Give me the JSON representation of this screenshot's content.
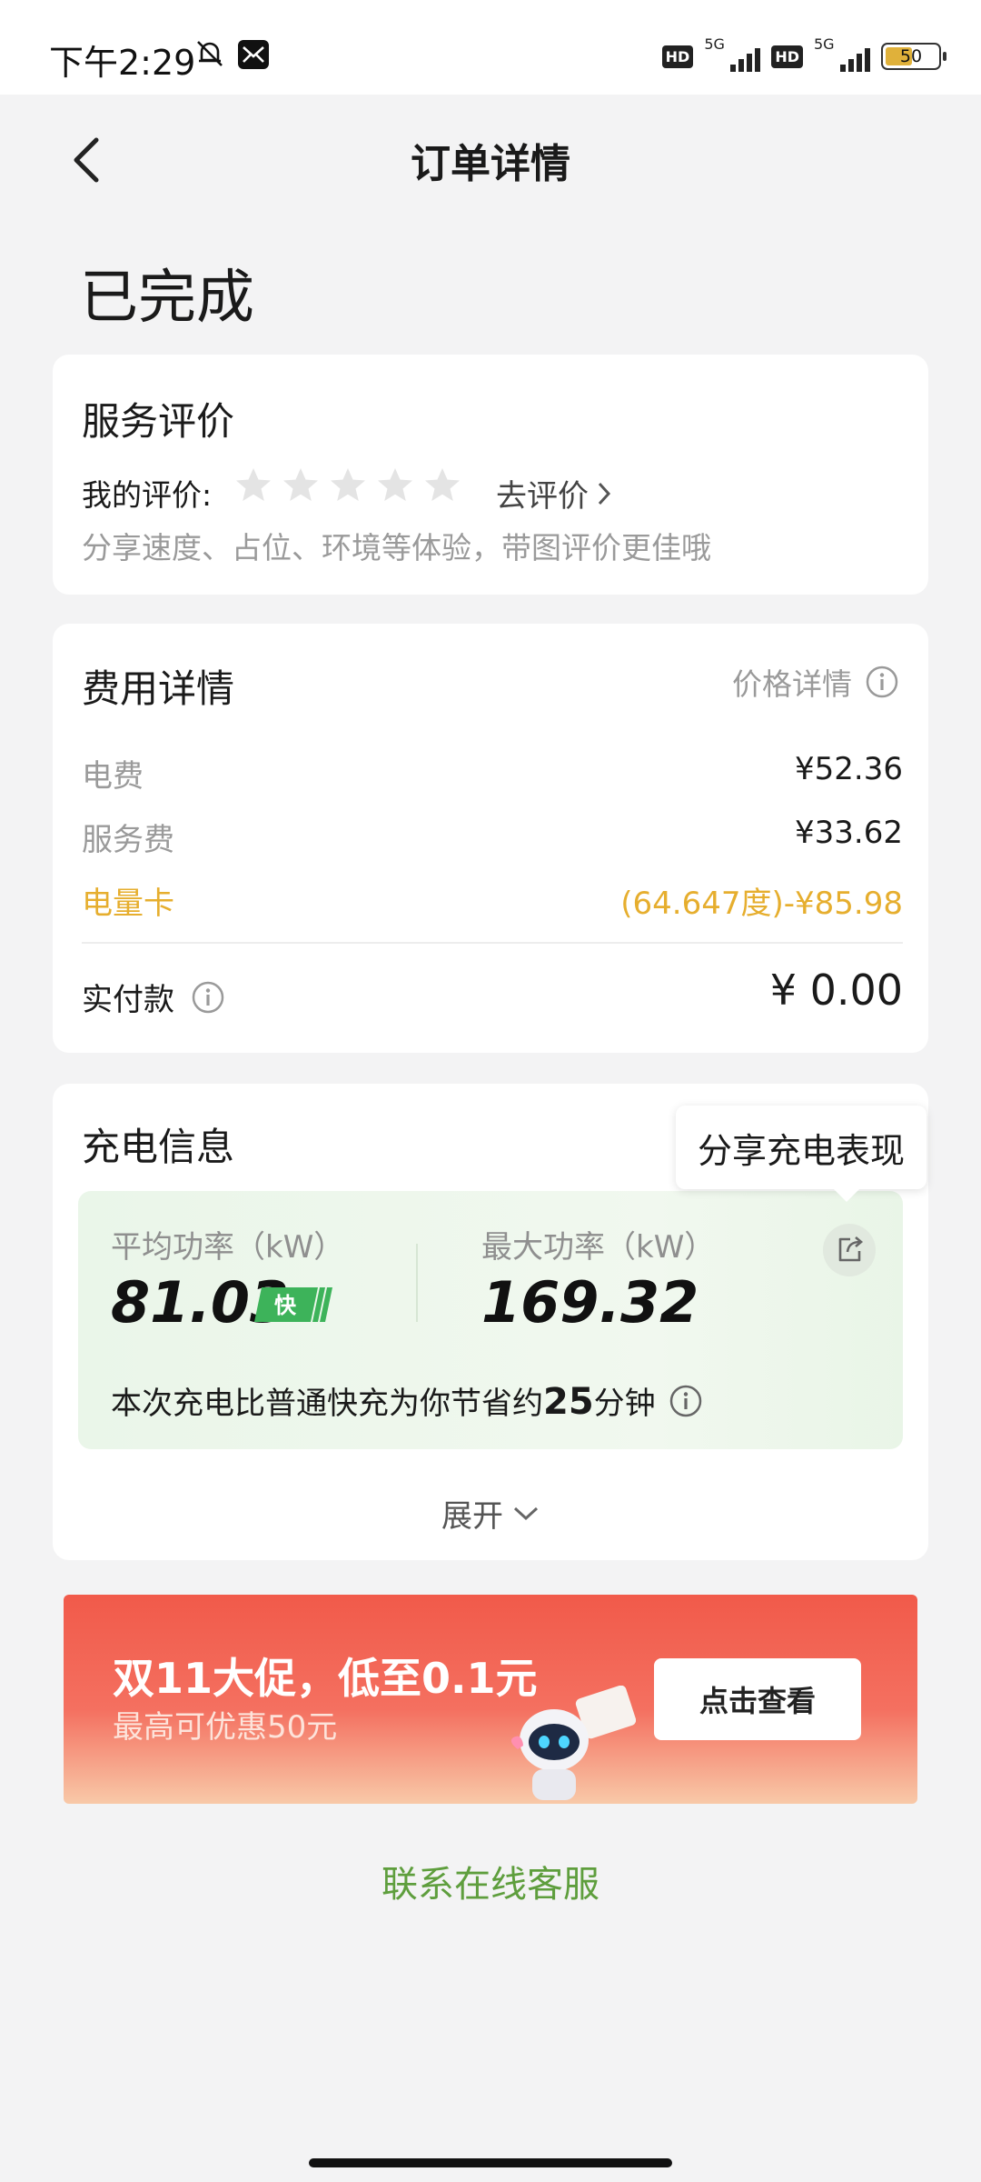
{
  "status_bar": {
    "time": "下午2:29",
    "network_1": "5G",
    "network_2": "5G",
    "hd_1": "HD",
    "hd_2": "HD",
    "battery": "50"
  },
  "header": {
    "title": "订单详情"
  },
  "order_status": "已完成",
  "rating": {
    "title": "服务评价",
    "my_rating_label": "我的评价:",
    "stars_filled": 0,
    "stars_total": 5,
    "go_rate": "去评价",
    "hint": "分享速度、占位、环境等体验，带图评价更佳哦"
  },
  "fee": {
    "title": "费用详情",
    "price_detail": "价格详情",
    "rows": [
      {
        "label": "电费",
        "value": "¥52.36"
      },
      {
        "label": "服务费",
        "value": "¥33.62"
      },
      {
        "label": "电量卡",
        "value": "(64.647度)-¥85.98"
      }
    ],
    "paid_label": "实付款",
    "paid_value": "¥ 0.00"
  },
  "charge": {
    "title": "充电信息",
    "tooltip": "分享充电表现",
    "avg_power_label": "平均功率（kW）",
    "avg_power_value": "81.03",
    "fast_badge": "快",
    "max_power_label": "最大功率（kW）",
    "max_power_value": "169.32",
    "save_prefix": "本次充电比普通快充为你节省约",
    "save_minutes": "25",
    "save_suffix": "分钟",
    "expand": "展开"
  },
  "banner": {
    "title": "双11大促，低至0.1元",
    "subtitle": "最高可优惠50元",
    "button": "点击查看"
  },
  "service_link": "联系在线客服",
  "colors": {
    "accent_green": "#5e9e3d",
    "gold": "#e6ae2e",
    "banner_red": "#f15a4a"
  }
}
